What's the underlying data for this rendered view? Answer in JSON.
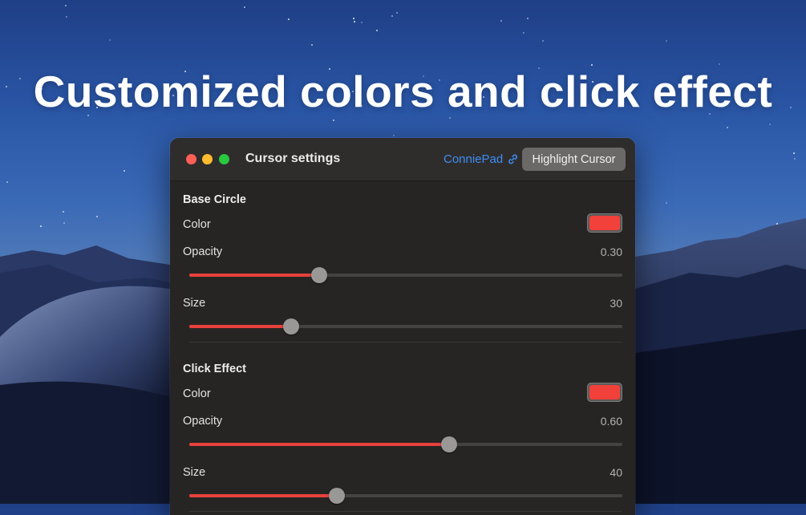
{
  "headline": "Customized colors and click effect",
  "window": {
    "title": "Cursor settings",
    "link_label": "ConniePad",
    "link_icon": "link-icon",
    "highlight_button": "Highlight Cursor"
  },
  "base_circle": {
    "title": "Base Circle",
    "color_label": "Color",
    "color_value": "#f2403a",
    "opacity_label": "Opacity",
    "opacity_value": "0.30",
    "opacity_fraction": 0.3,
    "size_label": "Size",
    "size_value": "30",
    "size_fraction": 0.235
  },
  "click_effect": {
    "title": "Click Effect",
    "color_label": "Color",
    "color_value": "#f2403a",
    "opacity_label": "Opacity",
    "opacity_value": "0.60",
    "opacity_fraction": 0.6,
    "size_label": "Size",
    "size_value": "40",
    "size_fraction": 0.34
  },
  "colors": {
    "accent": "#e8413c",
    "link": "#3d8ef7"
  }
}
